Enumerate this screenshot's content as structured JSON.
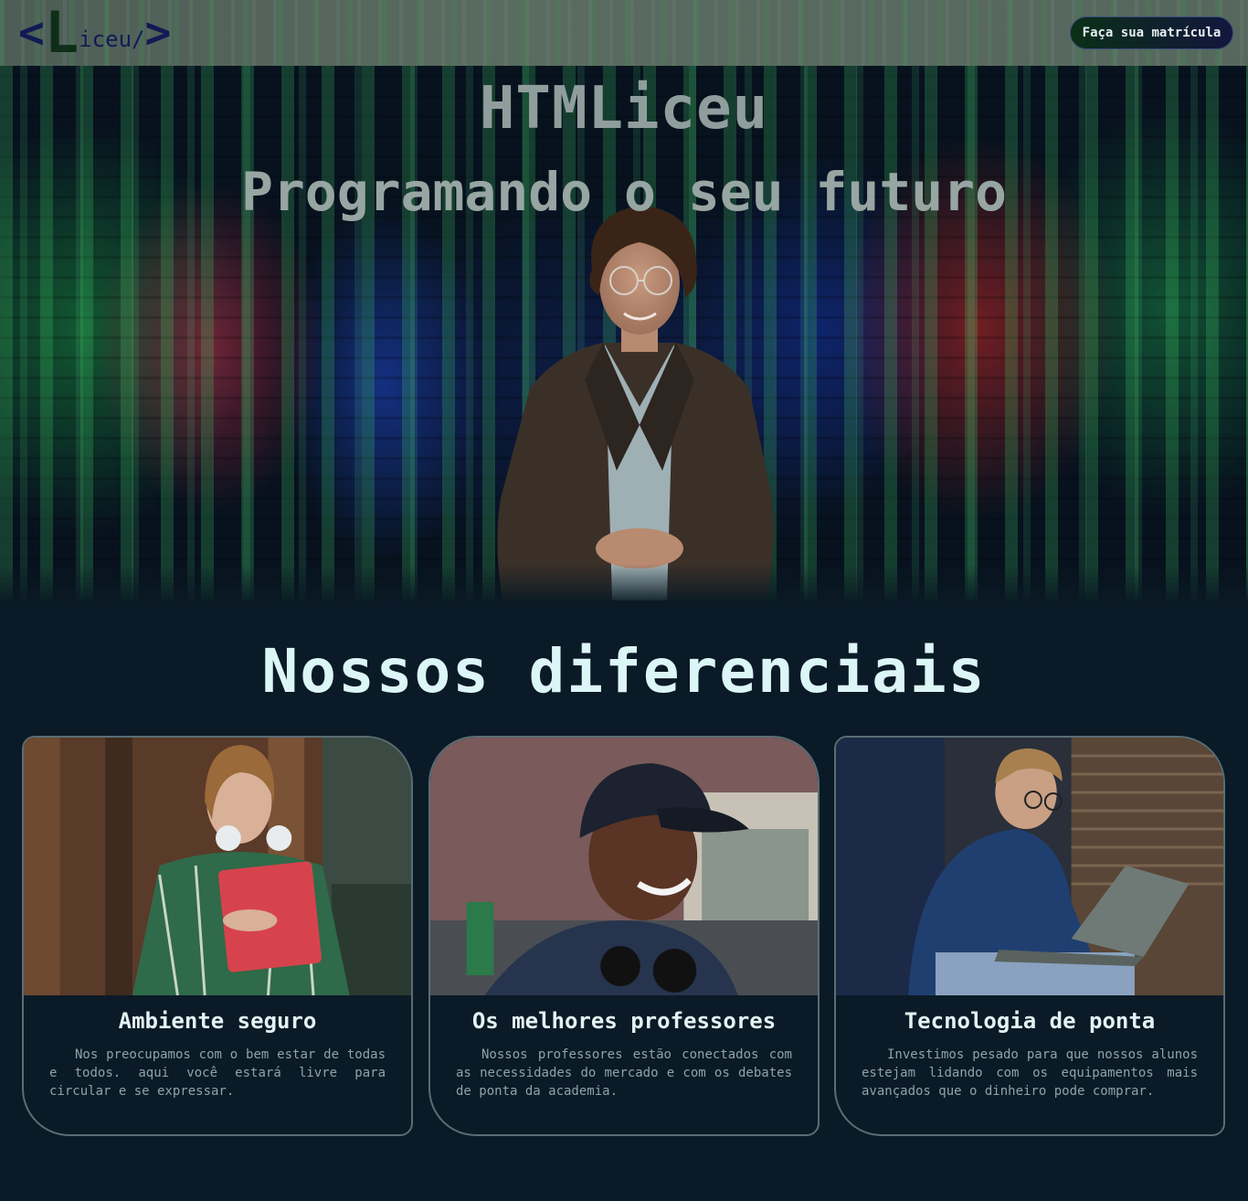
{
  "header": {
    "logo": {
      "open_bracket": "<",
      "letter": "L",
      "word": "iceu/",
      "close_bracket": ">"
    },
    "cta_label": "Faça sua matrícula"
  },
  "hero": {
    "title": "HTMLiceu",
    "subtitle": "Programando o seu futuro"
  },
  "features": {
    "title": "Nossos diferenciais",
    "cards": [
      {
        "title": "Ambiente seguro",
        "text": "Nos preocupamos com o bem estar de todas e todos. aqui você estará livre para circular e se expressar."
      },
      {
        "title": "Os melhores professores",
        "text": "Nossos professores estão conectados com as necessidades do mercado e com os debates de ponta da academia."
      },
      {
        "title": "Tecnologia de ponta",
        "text": "Investimos pesado para que nossos alunos estejam lidando com os equipamentos mais avançados que o dinheiro pode comprar."
      }
    ]
  },
  "colors": {
    "page_background": "#0b1a27",
    "header_background": "#56685e",
    "logo_color": "#121a55",
    "heading_color": "#dcf5f6",
    "card_border": "#5a6d74"
  }
}
